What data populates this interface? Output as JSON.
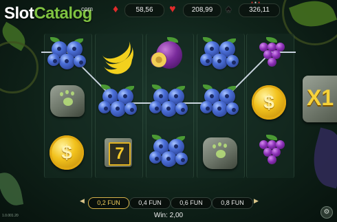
{
  "logo": {
    "part1": "Slot",
    "part2": "Catalog",
    "sup": "com"
  },
  "balances": [
    {
      "suit_icon": "diamond-icon",
      "value": "58,56",
      "color": "#e02b2b"
    },
    {
      "suit_icon": "heart-icon",
      "value": "208,99",
      "color": "#e02b2b"
    },
    {
      "suit_icon": "spade-icon",
      "value": "326,11",
      "color": "#111111"
    }
  ],
  "reels": [
    [
      "blueberries",
      "stone-paw",
      "gold-coin"
    ],
    [
      "banana",
      "blueberries",
      "seven"
    ],
    [
      "plum",
      "blueberries",
      "blueberries"
    ],
    [
      "blueberries",
      "blueberries",
      "stone-paw"
    ],
    [
      "grapes",
      "gold-coin",
      "grapes"
    ]
  ],
  "symbols": {
    "coin_glyph": "$",
    "seven_glyph": "7"
  },
  "multiplier": "X1",
  "bets": [
    {
      "label": "0,2 FUN",
      "selected": true
    },
    {
      "label": "0,4 FUN",
      "selected": false
    },
    {
      "label": "0,6 FUN",
      "selected": false
    },
    {
      "label": "0,8 FUN",
      "selected": false
    }
  ],
  "win": {
    "label": "Win:",
    "amount": "2,00"
  },
  "version": "1.0.001.20",
  "colors": {
    "accent": "#7fc241",
    "gold": "#f3cf5c",
    "win_line": "#e8f0ff"
  }
}
